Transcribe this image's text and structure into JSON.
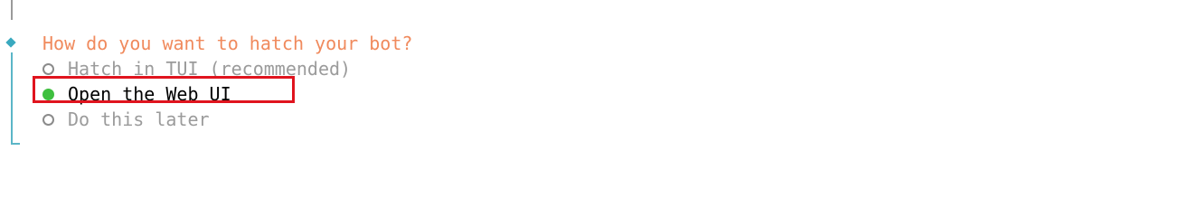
{
  "prompt": {
    "question": "How do you want to hatch your bot?",
    "options": [
      {
        "label": "Hatch in TUI (recommended)",
        "selected": false
      },
      {
        "label": "Open the Web UI",
        "selected": true
      },
      {
        "label": "Do this later",
        "selected": false
      }
    ]
  },
  "colors": {
    "question": "#f08a5d",
    "accent": "#3aa9bf",
    "selected_radio": "#3fbf3f",
    "highlight_box": "#e0141e",
    "dim_text": "#9b9b9b"
  },
  "icons": {
    "step_marker": "diamond-icon",
    "unselected": "radio-empty-icon",
    "selected": "radio-filled-icon"
  }
}
